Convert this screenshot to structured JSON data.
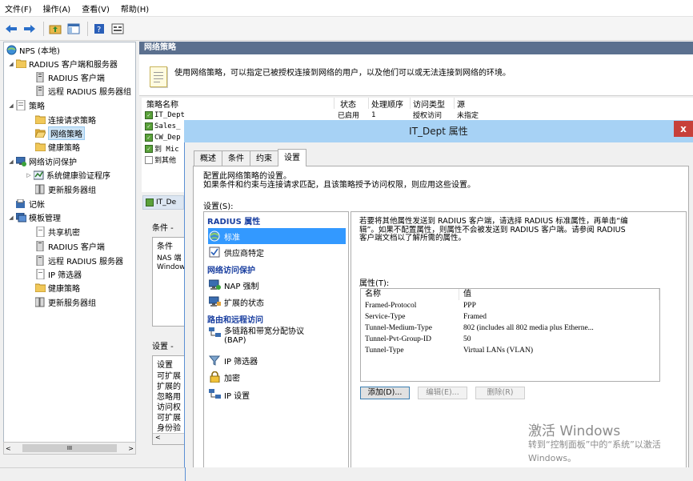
{
  "menu": [
    "文件(F)",
    "操作(A)",
    "查看(V)",
    "帮助(H)"
  ],
  "toolbar": {
    "icons": [
      "back-arrow-icon",
      "forward-arrow-icon",
      "folder-up-icon",
      "show-hide-tree-icon",
      "help-icon",
      "properties-icon"
    ]
  },
  "tree": {
    "items": [
      {
        "label": "NPS (本地)"
      },
      {
        "label": "RADIUS 客户端和服务器"
      },
      {
        "label": "RADIUS 客户端"
      },
      {
        "label": "远程 RADIUS 服务器组"
      },
      {
        "label": "策略"
      },
      {
        "label": "连接请求策略"
      },
      {
        "label": "网络策略"
      },
      {
        "label": "健康策略"
      },
      {
        "label": "网络访问保护"
      },
      {
        "label": "系统健康验证程序"
      },
      {
        "label": "更新服务器组"
      },
      {
        "label": "记帐"
      },
      {
        "label": "模板管理"
      },
      {
        "label": "共享机密"
      },
      {
        "label": "RADIUS 客户端"
      },
      {
        "label": "远程 RADIUS 服务器"
      },
      {
        "label": "IP 筛选器"
      },
      {
        "label": "健康策略"
      },
      {
        "label": "更新服务器组"
      }
    ],
    "scroll_thumb": "III"
  },
  "main": {
    "header": "网络策略",
    "description": "使用网络策略，可以指定已被授权连接到网络的用户，以及他们可以或无法连接到网络的环境。",
    "columns": [
      "策略名称",
      "状态",
      "处理顺序",
      "访问类型",
      "源"
    ],
    "rows": [
      {
        "name": "IT_Dept",
        "status": "已启用",
        "order": "1",
        "access": "授权访问",
        "source": "未指定"
      },
      {
        "name": "Sales_",
        "status": "",
        "order": "",
        "access": "",
        "source": ""
      },
      {
        "name": "CW_Dep",
        "status": "",
        "order": "",
        "access": "",
        "source": ""
      },
      {
        "name": "到 Mic",
        "status": "",
        "order": "",
        "access": "",
        "source": ""
      },
      {
        "name": "到其他",
        "status": "",
        "order": "",
        "access": "",
        "source": ""
      }
    ],
    "detail_title": "IT_De",
    "cond_header": "条件 -",
    "cond_col": "条件",
    "cond_rows": [
      "NAS 端",
      "Window"
    ],
    "settings_header": "设置 -",
    "settings_col": "设置",
    "settings_rows": [
      "可扩展",
      "扩展的",
      "忽略用",
      "访问权",
      "可扩展",
      "身份验"
    ]
  },
  "dialog": {
    "title": "IT_Dept 属性",
    "close": "x",
    "tabs": [
      "概述",
      "条件",
      "约束",
      "设置"
    ],
    "active_tab": "设置",
    "intro_line1": "配置此网络策略的设置。",
    "intro_line2": "如果条件和约束与连接请求匹配，且该策略授予访问权限，则应用这些设置。",
    "settings_label": "设置(S):",
    "list": [
      {
        "type": "cat",
        "label": "RADIUS 属性"
      },
      {
        "type": "item",
        "label": "标准",
        "icon": "globe-icon",
        "selected": true
      },
      {
        "type": "item",
        "label": "供应商特定",
        "icon": "checkbox-icon"
      },
      {
        "type": "cat",
        "label": "网络访问保护"
      },
      {
        "type": "item",
        "label": "NAP 强制",
        "icon": "monitor-icon"
      },
      {
        "type": "item",
        "label": "扩展的状态",
        "icon": "monitor-icon"
      },
      {
        "type": "cat",
        "label": "路由和远程访问"
      },
      {
        "type": "item",
        "label": "多链路和带宽分配协议\n(BAP)",
        "icon": "network-icon"
      },
      {
        "type": "item",
        "label": "IP 筛选器",
        "icon": "filter-icon"
      },
      {
        "type": "item",
        "label": "加密",
        "icon": "lock-icon"
      },
      {
        "type": "item",
        "label": "IP 设置",
        "icon": "network-icon"
      }
    ],
    "info_line1": "若要将其他属性发送到 RADIUS 客户端，请选择 RADIUS 标准属性，再单击“编",
    "info_line2": "辑”。如果不配置属性，则属性不会被发送到 RADIUS 客户端。请参阅 RADIUS",
    "info_line3": "客户端文档以了解所需的属性。",
    "attr_label": "属性(T):",
    "attr_columns": [
      "名称",
      "值"
    ],
    "attributes": [
      {
        "name": "Framed-Protocol",
        "value": "PPP"
      },
      {
        "name": "Service-Type",
        "value": "Framed"
      },
      {
        "name": "Tunnel-Medium-Type",
        "value": "802 (includes all 802 media plus Etherne..."
      },
      {
        "name": "Tunnel-Pvt-Group-ID",
        "value": "50"
      },
      {
        "name": "Tunnel-Type",
        "value": "Virtual LANs (VLAN)"
      }
    ],
    "buttons": {
      "add": "添加(D)...",
      "edit": "编辑(E)...",
      "remove": "删除(R)"
    }
  },
  "watermark": {
    "line1": "激活 Windows",
    "line2": "转到“控制面板”中的“系统”以激活",
    "line3": "Windows。"
  },
  "colors": {
    "dialog_title_bg": "#a7d2f5",
    "close_bg": "#c7403a",
    "selection": "#3399ff",
    "category": "#1a3fa0",
    "pane_header": "#5b708f"
  }
}
